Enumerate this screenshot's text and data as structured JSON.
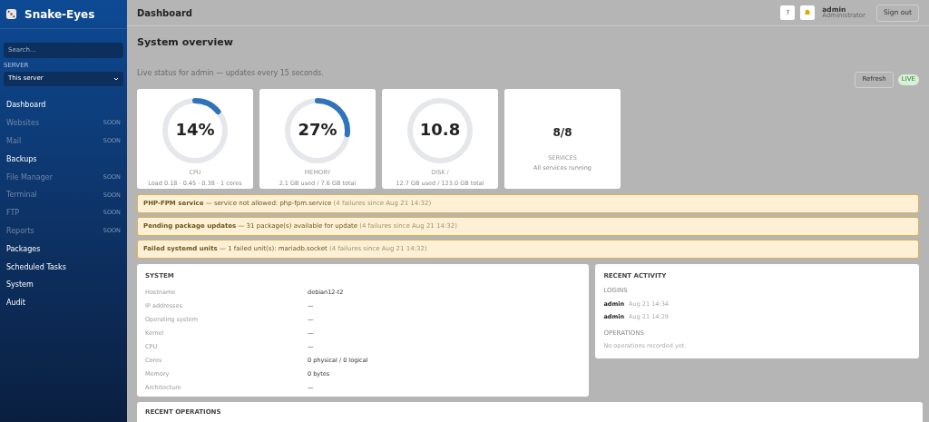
{
  "brand": {
    "name": "Snake-Eyes"
  },
  "sidebar": {
    "search": {
      "placeholder": "Search..."
    },
    "server_label": "SERVER",
    "server_select": "This server",
    "items": [
      {
        "label": "Dashboard",
        "disabled": false
      },
      {
        "label": "Websites",
        "disabled": true,
        "badge": "SOON"
      },
      {
        "label": "Mail",
        "disabled": true,
        "badge": "SOON"
      },
      {
        "label": "Backups",
        "disabled": false
      },
      {
        "label": "File Manager",
        "disabled": true,
        "badge": "SOON"
      },
      {
        "label": "Terminal",
        "disabled": true,
        "badge": "SOON"
      },
      {
        "label": "FTP",
        "disabled": true,
        "badge": "SOON"
      },
      {
        "label": "Reports",
        "disabled": true,
        "badge": "SOON"
      },
      {
        "label": "Packages",
        "disabled": false
      },
      {
        "label": "Scheduled Tasks",
        "disabled": false
      },
      {
        "label": "System",
        "disabled": false
      },
      {
        "label": "Audit",
        "disabled": false
      }
    ]
  },
  "header": {
    "title": "Dashboard",
    "help": "?",
    "user": "admin",
    "role": "Administrator",
    "sign_out": "Sign out"
  },
  "overview": {
    "title": "System overview",
    "subtitle": "Live status for admin — updates every 15 seconds.",
    "refresh": "Refresh",
    "live": "LIVE"
  },
  "stats": [
    {
      "kind": "gauge",
      "value": "14%",
      "level": 0.14,
      "label": "CPU",
      "detail": "Load 0.18 · 0.45 · 0.38 · 1 cores"
    },
    {
      "kind": "gauge",
      "value": "27%",
      "level": 0.27,
      "label": "MEMORY",
      "detail": "2.1 GB used / 7.6 GB total"
    },
    {
      "kind": "gauge",
      "value": "10.8",
      "level": 0,
      "label": "DISK /",
      "detail": "12.7 GB used / 123.0 GB total"
    },
    {
      "kind": "count",
      "value": "8/8",
      "label": "SERVICES",
      "detail": "All services running"
    }
  ],
  "alerts": [
    {
      "title": "PHP-FPM service",
      "message": "— service not allowed: php-fpm.service",
      "meta": "(4 failures since Aug 21 14:32)"
    },
    {
      "title": "Pending package updates",
      "message": "— 31 package(s) available for update",
      "meta": "(4 failures since Aug 21 14:32)"
    },
    {
      "title": "Failed systemd units",
      "message": "— 1 failed unit(s): mariadb.socket",
      "meta": "(4 failures since Aug 21 14:32)"
    }
  ],
  "system": {
    "title": "SYSTEM",
    "rows": [
      {
        "label": "Hostname",
        "value": "debian12-t2"
      },
      {
        "label": "IP addresses",
        "value": "—"
      },
      {
        "label": "Operating system",
        "value": "—"
      },
      {
        "label": "Kernel",
        "value": "—"
      },
      {
        "label": "CPU",
        "value": "—"
      },
      {
        "label": "Cores",
        "value": "0 physical / 0 logical"
      },
      {
        "label": "Memory",
        "value": "0 bytes"
      },
      {
        "label": "Architecture",
        "value": "—"
      }
    ]
  },
  "activity": {
    "title": "RECENT ACTIVITY",
    "logins_label": "LOGINS",
    "logins": [
      {
        "user": "admin",
        "time": "Aug 21 14:34"
      },
      {
        "user": "admin",
        "time": "Aug 21 14:29"
      }
    ],
    "operations_label": "OPERATIONS",
    "operations_empty": "No operations recorded yet."
  },
  "recent_operations": {
    "title": "RECENT OPERATIONS"
  }
}
